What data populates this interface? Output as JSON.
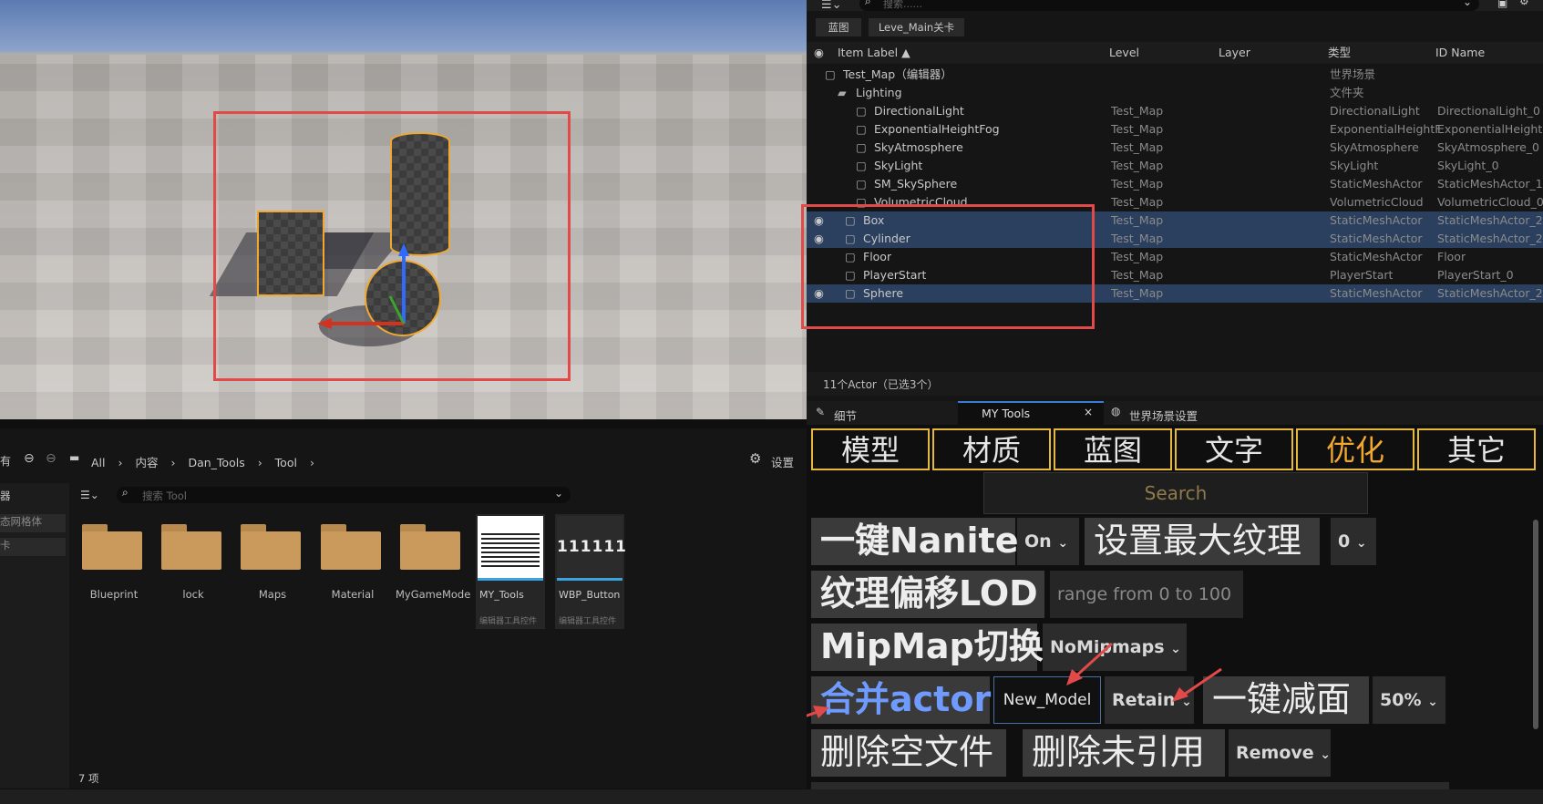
{
  "outliner": {
    "toolbar_search_placeholder": "搜索......",
    "chips": [
      "蓝图",
      "Leve_Main关卡"
    ],
    "columns": [
      "Item Label ▲",
      "Level",
      "Layer",
      "类型",
      "ID Name"
    ],
    "rows": [
      {
        "label": "Test_Map（编辑器）",
        "level": "",
        "type": "世界场景",
        "id": "",
        "selected": false,
        "eye": false
      },
      {
        "label": "Lighting",
        "level": "",
        "type": "文件夹",
        "id": "",
        "selected": false,
        "eye": false
      },
      {
        "label": "DirectionalLight",
        "level": "Test_Map",
        "type": "DirectionalLight",
        "id": "DirectionalLight_0",
        "selected": false,
        "eye": false
      },
      {
        "label": "ExponentialHeightFog",
        "level": "Test_Map",
        "type": "ExponentialHeightF",
        "id": "ExponentialHeightF",
        "selected": false,
        "eye": false
      },
      {
        "label": "SkyAtmosphere",
        "level": "Test_Map",
        "type": "SkyAtmosphere",
        "id": "SkyAtmosphere_0",
        "selected": false,
        "eye": false
      },
      {
        "label": "SkyLight",
        "level": "Test_Map",
        "type": "SkyLight",
        "id": "SkyLight_0",
        "selected": false,
        "eye": false
      },
      {
        "label": "SM_SkySphere",
        "level": "Test_Map",
        "type": "StaticMeshActor",
        "id": "StaticMeshActor_1",
        "selected": false,
        "eye": false
      },
      {
        "label": "VolumetricCloud",
        "level": "Test_Map",
        "type": "VolumetricCloud",
        "id": "VolumetricCloud_0",
        "selected": false,
        "eye": false
      },
      {
        "label": "Box",
        "level": "Test_Map",
        "type": "StaticMeshActor",
        "id": "StaticMeshActor_2",
        "selected": true,
        "eye": true
      },
      {
        "label": "Cylinder",
        "level": "Test_Map",
        "type": "StaticMeshActor",
        "id": "StaticMeshActor_2",
        "selected": true,
        "eye": true
      },
      {
        "label": "Floor",
        "level": "Test_Map",
        "type": "StaticMeshActor",
        "id": "Floor",
        "selected": false,
        "eye": false
      },
      {
        "label": "PlayerStart",
        "level": "Test_Map",
        "type": "PlayerStart",
        "id": "PlayerStart_0",
        "selected": false,
        "eye": false
      },
      {
        "label": "Sphere",
        "level": "Test_Map",
        "type": "StaticMeshActor",
        "id": "StaticMeshActor_2",
        "selected": true,
        "eye": true
      }
    ],
    "status": "11个Actor（已选3个）"
  },
  "detail_tabs": {
    "details": "细节",
    "my_tools": "MY Tools",
    "world_settings": "世界场景设置"
  },
  "tools": {
    "tabs": [
      "模型",
      "材质",
      "蓝图",
      "文字",
      "优化",
      "其它"
    ],
    "active_tab_index": 4,
    "search_placeholder": "Search",
    "nanite_btn": "一键Nanite",
    "nanite_drop": "On",
    "max_tex_btn": "设置最大纹理",
    "max_tex_drop": "0",
    "lod_btn": "纹理偏移LOD",
    "lod_input_placeholder": "range from 0 to 100",
    "mip_btn": "MipMap切换",
    "mip_drop": "NoMipmaps",
    "merge_btn": "合并actor",
    "merge_name": "New_Model",
    "merge_drop": "Retain",
    "reduce_btn": "一键减面",
    "reduce_drop": "50%",
    "del_empty_btn": "删除空文件",
    "del_unref_btn": "删除未引用",
    "remove_drop": "Remove"
  },
  "content": {
    "breadcrumb": [
      "All",
      "内容",
      "Dan_Tools",
      "Tool"
    ],
    "settings": "设置",
    "left_trunc": "有",
    "side_items": [
      "器",
      "态网格体",
      "卡"
    ],
    "search_placeholder": "搜索 Tool",
    "folders": [
      "Blueprint",
      "lock",
      "Maps",
      "Material",
      "MyGameMode"
    ],
    "assets": [
      {
        "name": "MY_Tools",
        "kind": "编辑器工具控件",
        "thumb": ""
      },
      {
        "name": "WBP_Button",
        "kind": "编辑器工具控件",
        "thumb": "111111"
      }
    ],
    "count": "7 项"
  },
  "colors": {
    "accent_yellow": "#e7b93a",
    "active_tab_text": "#f0a830",
    "merge_text": "#6f9bff",
    "selection": "#2b3f5e",
    "annotation_red": "#e24a4a"
  }
}
